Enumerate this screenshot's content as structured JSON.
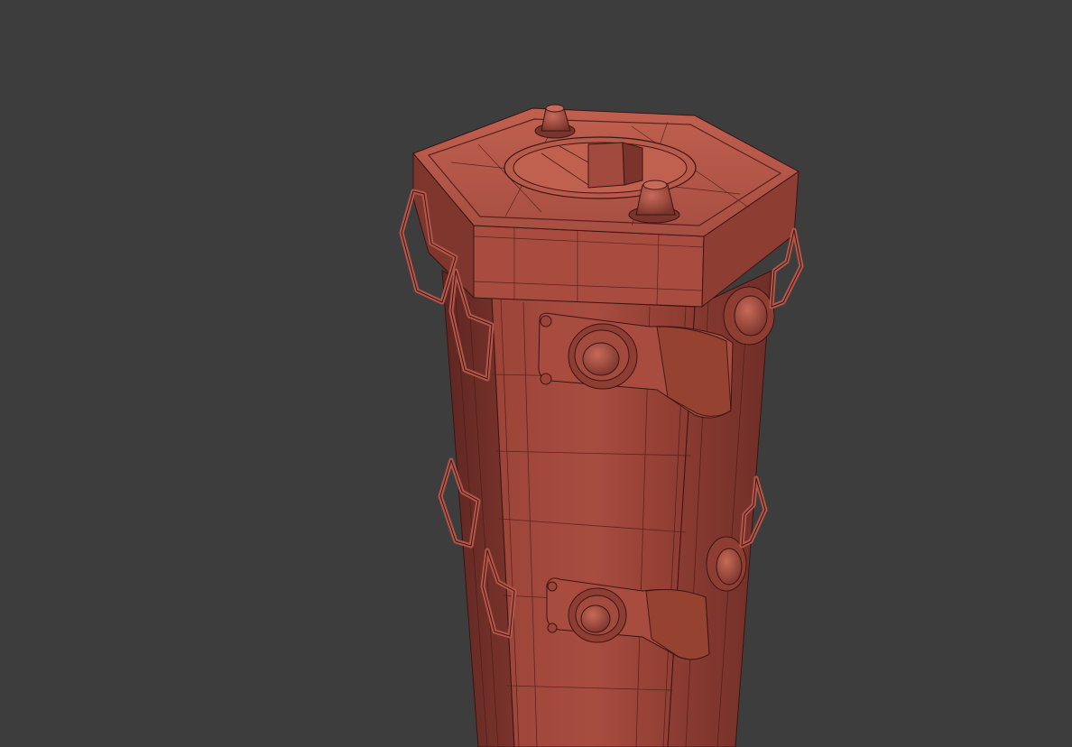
{
  "viewport": {
    "background": "#3d3d3d"
  },
  "model": {
    "shading": "wireframe-on-shaded",
    "base_color": "#b5564a",
    "shadow_color": "#6e2f28",
    "wire_color": "#3a1512"
  },
  "icons": [
    "knob-icon",
    "bolt-icon"
  ]
}
